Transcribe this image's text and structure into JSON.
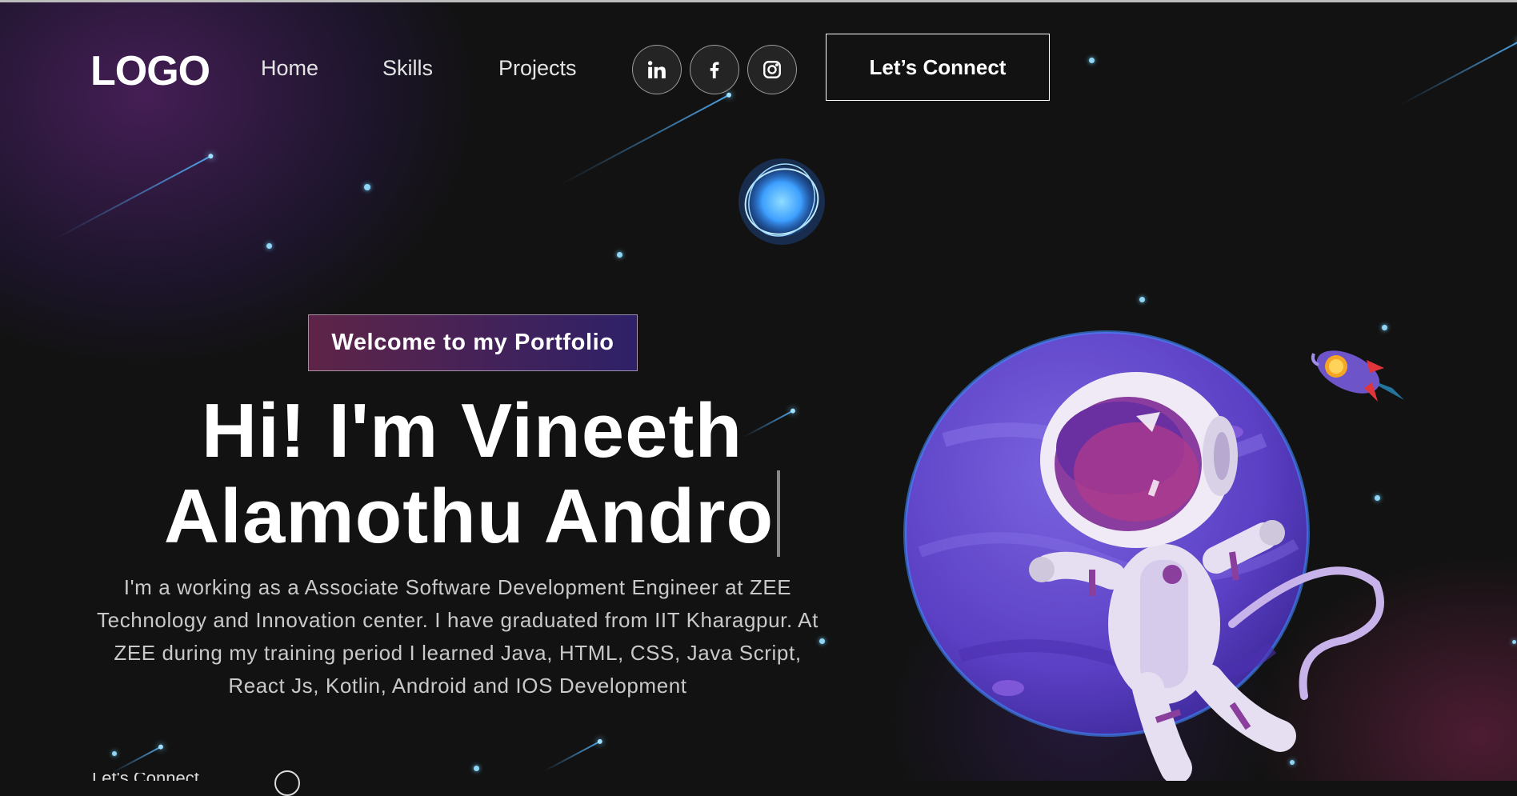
{
  "nav": {
    "logo": "LOGO",
    "links": [
      "Home",
      "Skills",
      "Projects"
    ],
    "social_icons": [
      "linkedin-icon",
      "facebook-icon",
      "instagram-icon"
    ],
    "connect_label": "Let’s Connect"
  },
  "hero": {
    "tagline": "Welcome to my Portfolio",
    "headline_line1": "Hi! I'm Vineeth",
    "headline_line2": "Alamothu Andro",
    "description": "I'm a working as a Associate Software Development Engineer at ZEE Technology and Innovation center. I have graduated from IIT Kharagpur. At ZEE during my training period I learned Java, HTML, CSS, Java Script, React Js, Kotlin, Android and IOS Development",
    "scroll_hint": "Let's Connect"
  },
  "colors": {
    "background": "#121212",
    "tagline_gradient_start": "#aa367c",
    "tagline_gradient_end": "#4a2fbd",
    "planet": "#6a4fd0",
    "star": "#8fd6f5"
  }
}
